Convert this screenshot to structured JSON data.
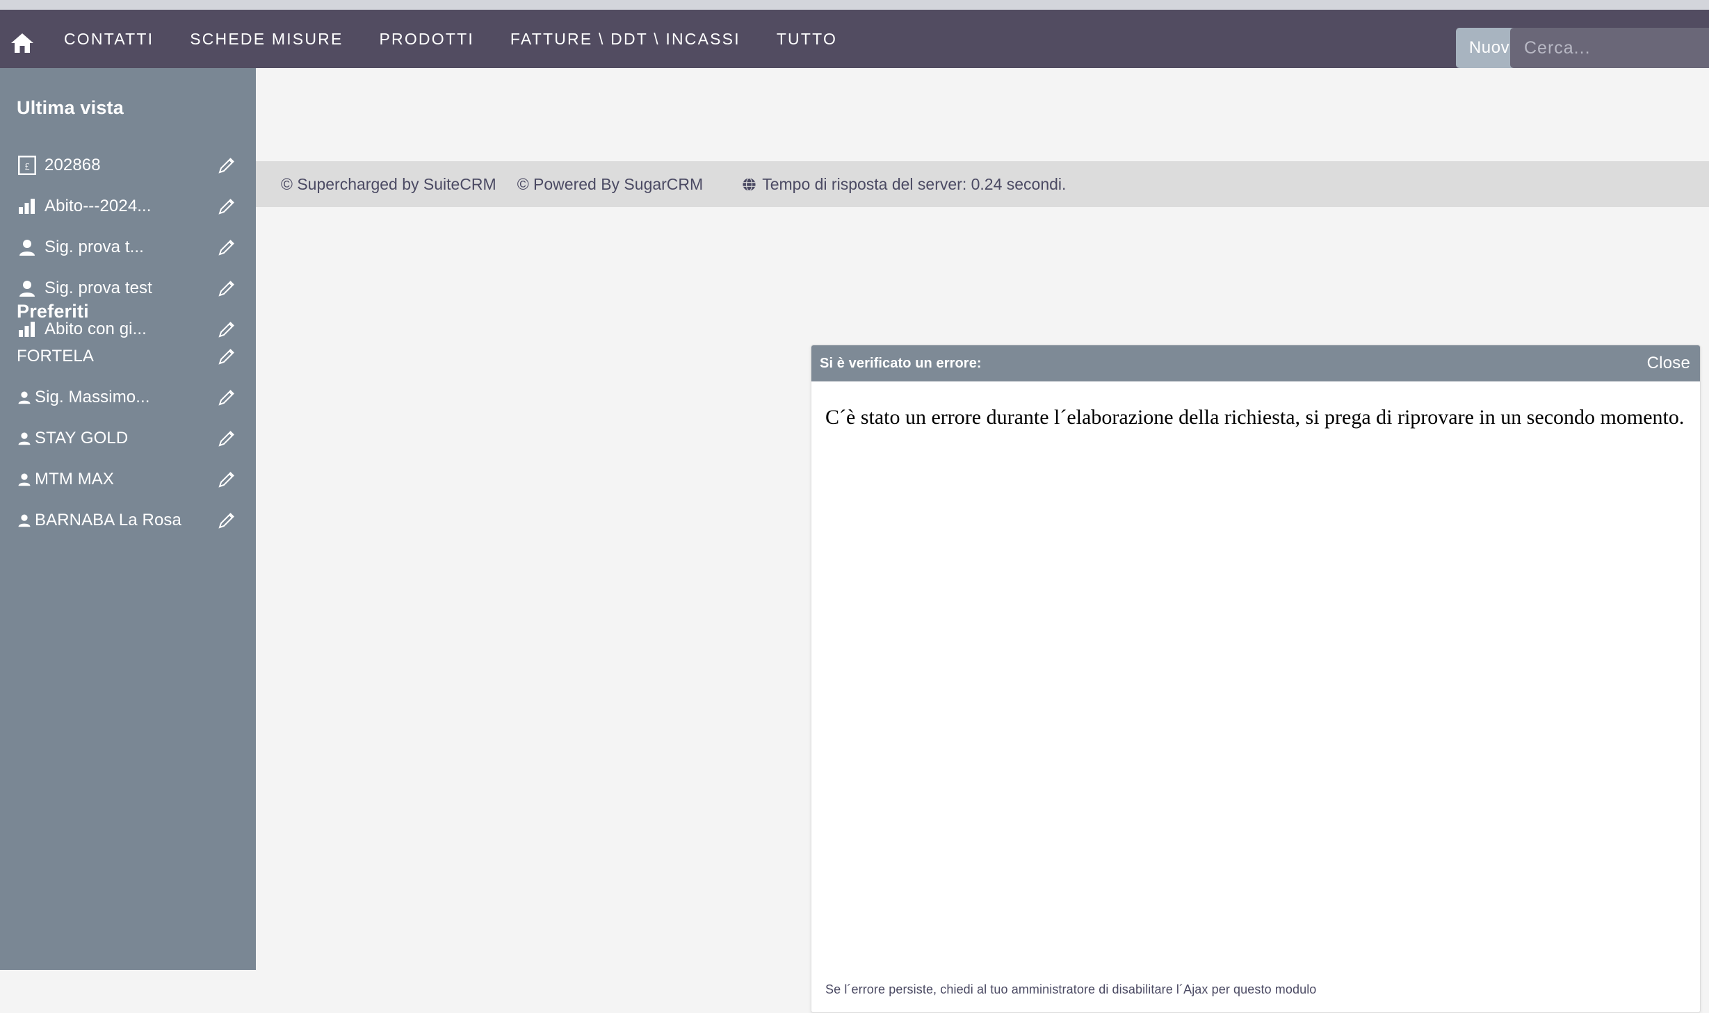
{
  "navbar": {
    "home_icon": "home-icon",
    "links": [
      {
        "label": "CONTATTI"
      },
      {
        "label": "SCHEDE MISURE"
      },
      {
        "label": "PRODOTTI"
      },
      {
        "label": "FATTURE \\ DDT \\ INCASSI"
      },
      {
        "label": "TUTTO"
      }
    ],
    "new_button": {
      "label": "Nuovo",
      "caret_icon": "chevron-down-icon"
    },
    "search": {
      "placeholder": "Cerca...",
      "value": ""
    },
    "background_color": "#524C61",
    "new_button_color": "#A8B4C0"
  },
  "sidebar": {
    "background_color": "#7A8794",
    "collapse_toggle_icon": "triangle-left-icon",
    "sections": [
      {
        "heading": "Ultima vista",
        "items": [
          {
            "label": "202868",
            "icon": "invoice-icon",
            "edit_icon": "pencil-icon"
          },
          {
            "label": "Abito---2024...",
            "icon": "bar-chart-icon",
            "edit_icon": "pencil-icon"
          },
          {
            "label": "Sig. prova t...",
            "icon": "person-icon",
            "edit_icon": "pencil-icon"
          },
          {
            "label": "Sig. prova test",
            "icon": "person-icon",
            "edit_icon": "pencil-icon"
          },
          {
            "label": "Abito con gi...",
            "icon": "bar-chart-icon",
            "edit_icon": "pencil-icon"
          }
        ]
      },
      {
        "heading": "Preferiti",
        "items": [
          {
            "label": "FORTELA",
            "icon": "",
            "edit_icon": "pencil-icon"
          },
          {
            "label": "Sig. Massimo...",
            "icon": "person-icon",
            "edit_icon": "pencil-icon"
          },
          {
            "label": "STAY GOLD",
            "icon": "person-icon",
            "edit_icon": "pencil-icon"
          },
          {
            "label": "MTM MAX",
            "icon": "person-icon",
            "edit_icon": "pencil-icon"
          },
          {
            "label": "BARNABA La Rosa",
            "icon": "person-icon",
            "edit_icon": "pencil-icon"
          }
        ]
      }
    ]
  },
  "credits": {
    "suitecrm": "© Supercharged by SuiteCRM",
    "sugarcrm": "© Powered By SugarCRM",
    "server_time": "Tempo di risposta del server: 0.24 secondi.",
    "globe_icon": "globe-icon",
    "background_color": "#DCDCDC"
  },
  "error_dialog": {
    "title": "Si è verificato un errore:",
    "close_label": "Close",
    "message": "C´è stato un errore durante l´elaborazione della richiesta, si prega di riprovare in un secondo momento.",
    "footnote": "Se l´errore persiste, chiedi al tuo amministratore di disabilitare l´Ajax per questo modulo",
    "header_color": "#7E8A96"
  }
}
